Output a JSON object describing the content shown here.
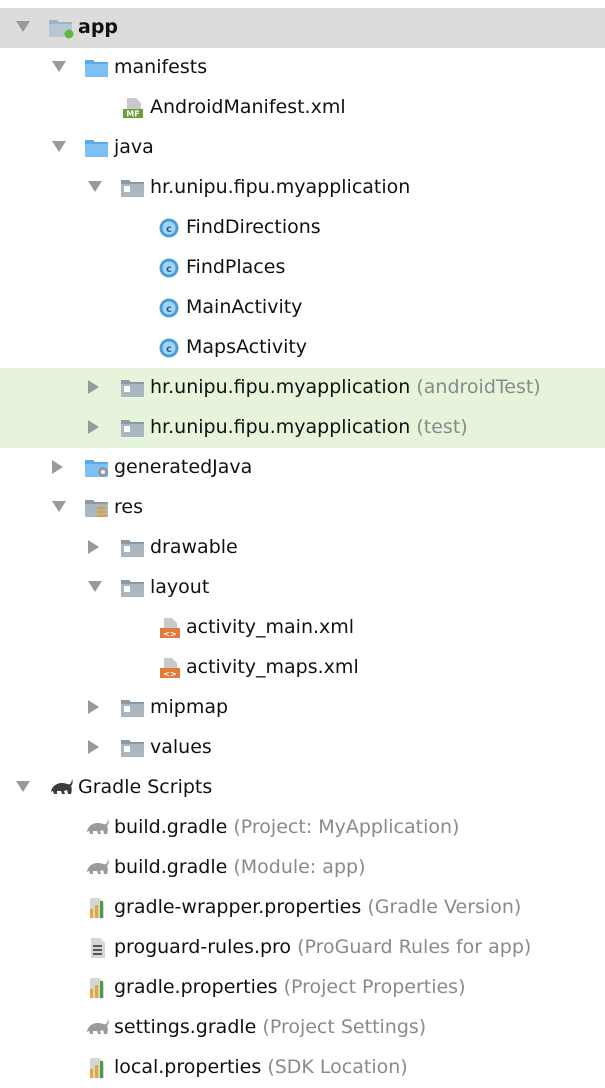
{
  "tree": [
    {
      "id": "app",
      "label": "app",
      "hint": "",
      "bold": true,
      "depth": 0,
      "arrow": "down",
      "icon": "module-folder-icon",
      "state": "selected"
    },
    {
      "id": "manifests",
      "label": "manifests",
      "hint": "",
      "depth": 1,
      "arrow": "down",
      "icon": "source-folder-icon"
    },
    {
      "id": "androidmanifest",
      "label": "AndroidManifest.xml",
      "hint": "",
      "depth": 2,
      "arrow": "none",
      "icon": "manifest-file-icon"
    },
    {
      "id": "java",
      "label": "java",
      "hint": "",
      "depth": 1,
      "arrow": "down",
      "icon": "source-folder-icon"
    },
    {
      "id": "package-main",
      "label": "hr.unipu.fipu.myapplication",
      "hint": "",
      "depth": 2,
      "arrow": "down",
      "icon": "package-icon"
    },
    {
      "id": "finddirections",
      "label": "FindDirections",
      "hint": "",
      "depth": 3,
      "arrow": "none",
      "icon": "java-class-icon"
    },
    {
      "id": "findplaces",
      "label": "FindPlaces",
      "hint": "",
      "depth": 3,
      "arrow": "none",
      "icon": "java-class-icon"
    },
    {
      "id": "mainactivity",
      "label": "MainActivity",
      "hint": "",
      "depth": 3,
      "arrow": "none",
      "icon": "java-class-icon"
    },
    {
      "id": "mapsactivity",
      "label": "MapsActivity",
      "hint": "",
      "depth": 3,
      "arrow": "none",
      "icon": "java-class-icon"
    },
    {
      "id": "package-androidtest",
      "label": "hr.unipu.fipu.myapplication",
      "hint": "(androidTest)",
      "depth": 2,
      "arrow": "right",
      "icon": "package-icon",
      "state": "highlight"
    },
    {
      "id": "package-test",
      "label": "hr.unipu.fipu.myapplication",
      "hint": "(test)",
      "depth": 2,
      "arrow": "right",
      "icon": "package-icon",
      "state": "highlight"
    },
    {
      "id": "generatedjava",
      "label": "generatedJava",
      "hint": "",
      "depth": 1,
      "arrow": "right",
      "icon": "generated-folder-icon"
    },
    {
      "id": "res",
      "label": "res",
      "hint": "",
      "depth": 1,
      "arrow": "down",
      "icon": "resource-folder-icon"
    },
    {
      "id": "drawable",
      "label": "drawable",
      "hint": "",
      "depth": 2,
      "arrow": "right",
      "icon": "folder-icon"
    },
    {
      "id": "layout",
      "label": "layout",
      "hint": "",
      "depth": 2,
      "arrow": "down",
      "icon": "folder-icon"
    },
    {
      "id": "activity-main-xml",
      "label": "activity_main.xml",
      "hint": "",
      "depth": 3,
      "arrow": "none",
      "icon": "layout-xml-icon"
    },
    {
      "id": "activity-maps-xml",
      "label": "activity_maps.xml",
      "hint": "",
      "depth": 3,
      "arrow": "none",
      "icon": "layout-xml-icon"
    },
    {
      "id": "mipmap",
      "label": "mipmap",
      "hint": "",
      "depth": 2,
      "arrow": "right",
      "icon": "folder-icon"
    },
    {
      "id": "values",
      "label": "values",
      "hint": "",
      "depth": 2,
      "arrow": "right",
      "icon": "folder-icon"
    },
    {
      "id": "gradle-scripts",
      "label": "Gradle Scripts",
      "hint": "",
      "depth": 0,
      "arrow": "down",
      "icon": "gradle-icon"
    },
    {
      "id": "build-gradle-project",
      "label": "build.gradle",
      "hint": "(Project: MyApplication)",
      "depth": 1,
      "arrow": "none",
      "icon": "gradle-file-icon"
    },
    {
      "id": "build-gradle-module",
      "label": "build.gradle",
      "hint": "(Module: app)",
      "depth": 1,
      "arrow": "none",
      "icon": "gradle-file-icon"
    },
    {
      "id": "gradle-wrapper-properties",
      "label": "gradle-wrapper.properties",
      "hint": "(Gradle Version)",
      "depth": 1,
      "arrow": "none",
      "icon": "properties-file-icon"
    },
    {
      "id": "proguard-rules",
      "label": "proguard-rules.pro",
      "hint": "(ProGuard Rules for app)",
      "depth": 1,
      "arrow": "none",
      "icon": "text-file-icon"
    },
    {
      "id": "gradle-properties",
      "label": "gradle.properties",
      "hint": "(Project Properties)",
      "depth": 1,
      "arrow": "none",
      "icon": "properties-file-icon"
    },
    {
      "id": "settings-gradle",
      "label": "settings.gradle",
      "hint": "(Project Settings)",
      "depth": 1,
      "arrow": "none",
      "icon": "gradle-file-icon"
    },
    {
      "id": "local-properties",
      "label": "local.properties",
      "hint": "(SDK Location)",
      "depth": 1,
      "arrow": "none",
      "icon": "properties-file-icon"
    }
  ]
}
